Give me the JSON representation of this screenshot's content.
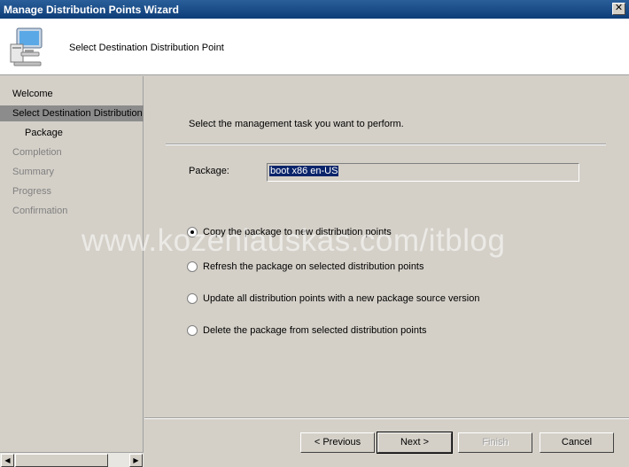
{
  "window": {
    "title": "Manage Distribution Points Wizard",
    "close_glyph": "✕"
  },
  "header": {
    "title": "Select Destination Distribution Point",
    "icon": "computer-monitor-icon"
  },
  "nav": {
    "items": [
      {
        "label": "Welcome",
        "state": "normal"
      },
      {
        "label": "Select Destination Distribution Point",
        "state": "selected"
      },
      {
        "label": "Package",
        "state": "normal"
      },
      {
        "label": "Completion",
        "state": "disabled"
      },
      {
        "label": "Summary",
        "state": "disabled"
      },
      {
        "label": "Progress",
        "state": "disabled"
      },
      {
        "label": "Confirmation",
        "state": "disabled"
      }
    ]
  },
  "content": {
    "instruction": "Select the management task you want to perform.",
    "package_label": "Package:",
    "package_value": "boot x86  en-US",
    "options": [
      {
        "label": "Copy the package to new distribution points",
        "checked": true
      },
      {
        "label": "Refresh the package on selected distribution points",
        "checked": false
      },
      {
        "label": "Update all distribution points with a new package source version",
        "checked": false
      },
      {
        "label": "Delete the package from selected distribution points",
        "checked": false
      }
    ]
  },
  "watermark": "www.kozeniauskas.com/itblog",
  "buttons": {
    "previous": "< Previous",
    "next": "Next >",
    "finish": "Finish",
    "cancel": "Cancel"
  },
  "scroll": {
    "left_glyph": "◀",
    "right_glyph": "▶"
  }
}
